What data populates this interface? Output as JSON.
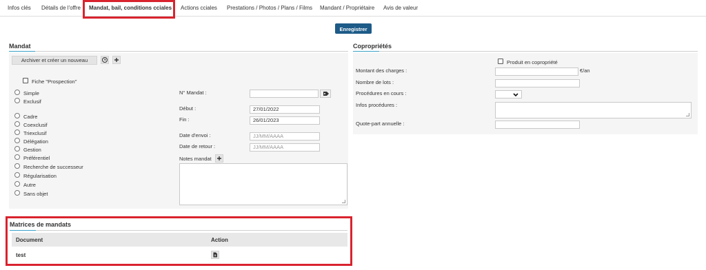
{
  "tabs": [
    {
      "label": "Infos clés"
    },
    {
      "label": "Détails de l'offre"
    },
    {
      "label": "Mandat, bail, conditions cciales"
    },
    {
      "label": "Actions cciales"
    },
    {
      "label": "Prestations / Photos / Plans / Films"
    },
    {
      "label": "Mandant / Propriétaire"
    },
    {
      "label": "Avis de valeur"
    }
  ],
  "save_label": "Enregistrer",
  "mandat": {
    "title": "Mandat",
    "archive_button": "Archiver et créer un nouveau",
    "fiche_prospection": "Fiche \"Prospection\"",
    "types_a": [
      "Simple",
      "Exclusif"
    ],
    "types_b": [
      "Cadre",
      "Coexclusif",
      "Triexclusif",
      "Délégation",
      "Gestion",
      "Préférentiel",
      "Recherche de successeur",
      "Régularisation",
      "Autre",
      "Sans objet"
    ],
    "numero_label": "N° Mandat :",
    "numero_value": "",
    "debut_label": "Début :",
    "debut_value": "27/01/2022",
    "fin_label": "Fin :",
    "fin_value": "26/01/2023",
    "envoi_label": "Date d'envoi :",
    "envoi_placeholder": "JJ/MM/AAAA",
    "retour_label": "Date de retour :",
    "retour_placeholder": "JJ/MM/AAAA",
    "notes_label": "Notes mandat"
  },
  "copro": {
    "title": "Copropriétés",
    "produit_label": "Produit en copropriété",
    "charges_label": "Montant des charges :",
    "charges_unit": "€/an",
    "lots_label": "Nombre de lots :",
    "procedures_label": "Procédures en cours :",
    "infos_label": "Infos procédures :",
    "quote_label": "Quote-part annuelle :"
  },
  "matrices": {
    "title": "Matrices de mandats",
    "col_document": "Document",
    "col_action": "Action",
    "rows": [
      {
        "document": "test"
      }
    ]
  },
  "colors": {
    "accent": "#1d5b88",
    "highlight": "#d9232e",
    "underline": "#3aa0c8"
  }
}
